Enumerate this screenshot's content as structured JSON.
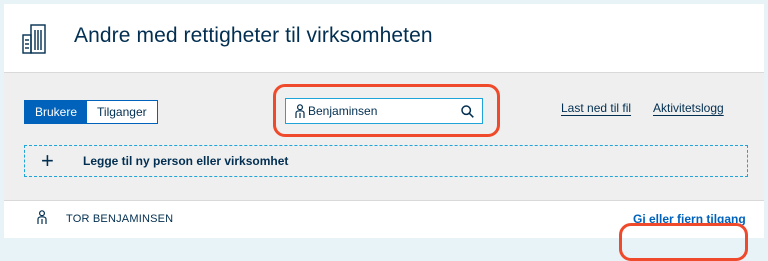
{
  "header": {
    "icon": "building-icon",
    "title": "Andre med rettigheter til virksomheten"
  },
  "toolbar": {
    "tabs": [
      {
        "label": "Brukere",
        "active": true
      },
      {
        "label": "Tilganger",
        "active": false
      }
    ],
    "search": {
      "value": "Benjaminsen",
      "placeholder": "",
      "icon_left": "person-icon",
      "icon_right": "search-icon"
    },
    "links": {
      "download": "Last ned til fil",
      "activity_log": "Aktivitetslogg"
    },
    "add_row": {
      "icon": "plus-icon",
      "symbol": "+",
      "label": "Legge til ny person eller virksomhet"
    }
  },
  "results": [
    {
      "icon": "person-icon",
      "name": "TOR BENJAMINSEN",
      "action_label": "Gi eller fjern tilgang"
    }
  ],
  "colors": {
    "brand": "#022f51",
    "accent": "#0062ba",
    "focus": "#1ea4d9",
    "highlight": "#ef4a2b",
    "toolbar_bg": "#efefef"
  }
}
